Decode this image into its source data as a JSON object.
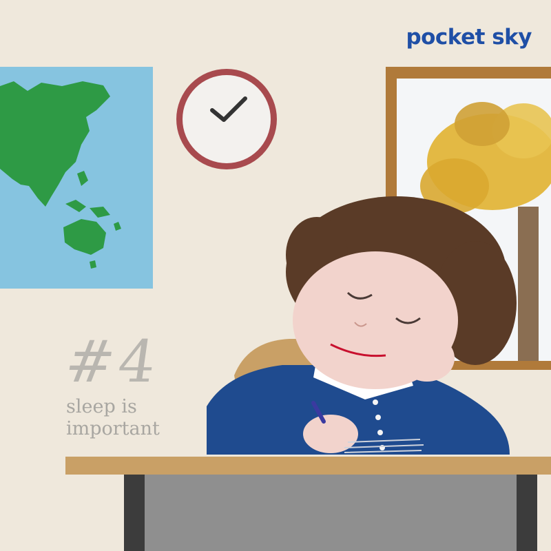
{
  "brand": {
    "logo_text": "pocket sky",
    "color": "#1f4fa6"
  },
  "episode": {
    "number": "#4",
    "title_line1": "sleep is",
    "title_line2": "important"
  },
  "colors": {
    "wall": "#efe8dc",
    "map_ocean": "#86c4e0",
    "map_land": "#2e9a45",
    "clock_rim": "#a84a4e",
    "desk_top": "#c9a066",
    "desk_front": "#8f8f8f",
    "uniform": "#1f4b8f",
    "hair": "#5a3b27",
    "skin": "#f2d3cc",
    "tree_leaves": "#e1b53a",
    "window_frame": "#b07a3a"
  }
}
